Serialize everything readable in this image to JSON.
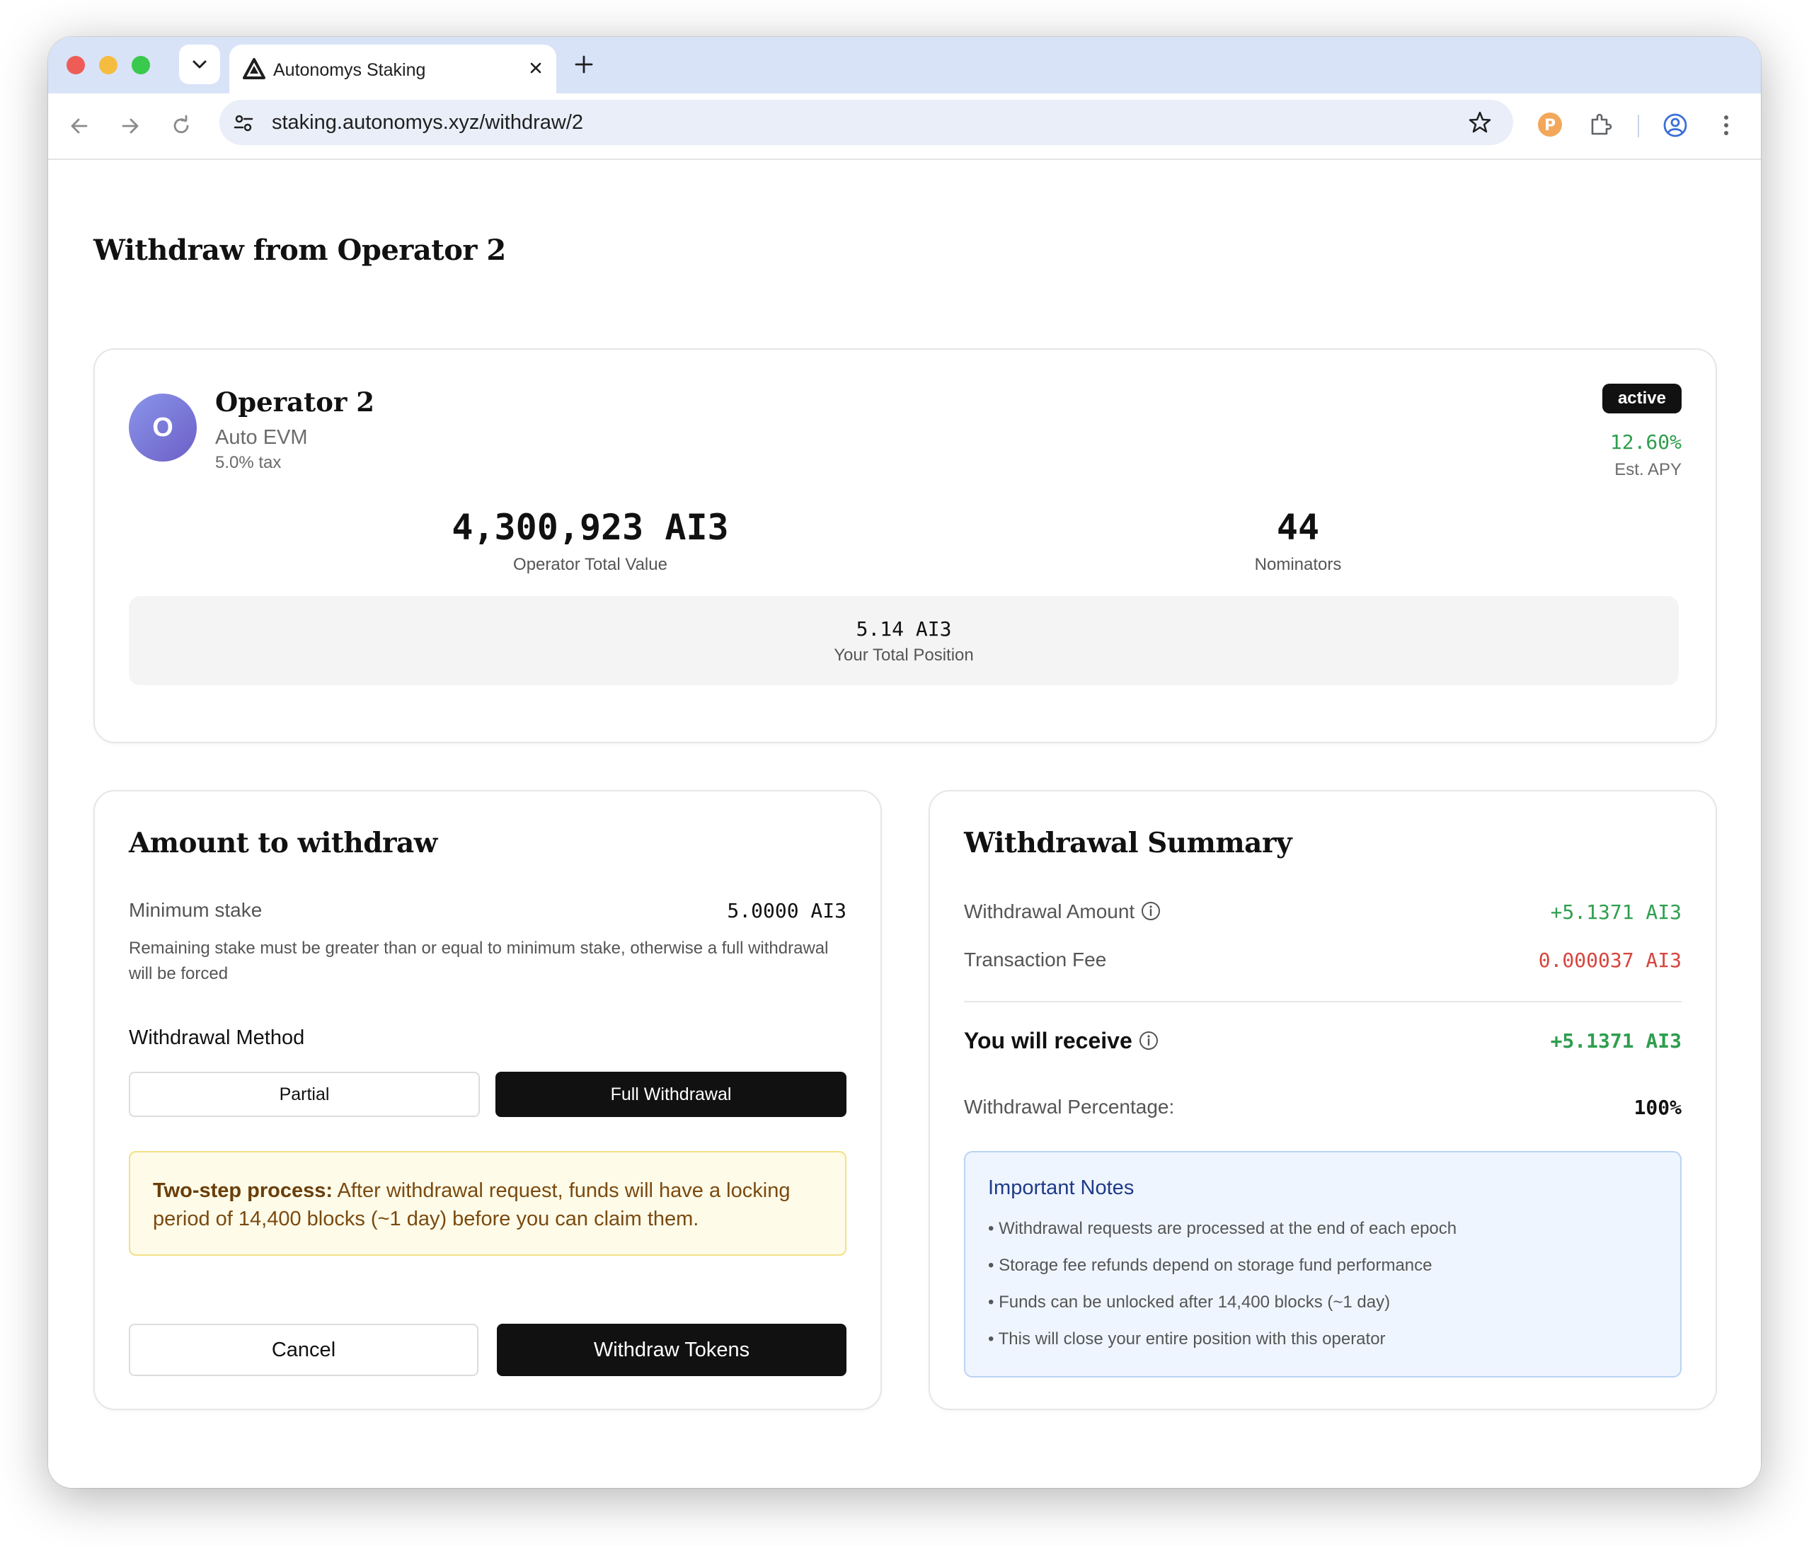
{
  "browser": {
    "tab_title": "Autonomys Staking",
    "url": "staking.autonomys.xyz/withdraw/2"
  },
  "page": {
    "title": "Withdraw from Operator 2"
  },
  "operator": {
    "avatar_letter": "O",
    "name": "Operator 2",
    "domain": "Auto EVM",
    "tax": "5.0% tax",
    "status": "active",
    "apy": "12.60%",
    "apy_label": "Est. APY",
    "total_value": "4,300,923 AI3",
    "total_value_label": "Operator Total Value",
    "nominators": "44",
    "nominators_label": "Nominators",
    "position": "5.14 AI3",
    "position_label": "Your Total Position"
  },
  "amount": {
    "title": "Amount to withdraw",
    "min_stake_label": "Minimum stake",
    "min_stake_value": "5.0000 AI3",
    "help": "Remaining stake must be greater than or equal to minimum stake, otherwise a full withdrawal will be forced",
    "method_label": "Withdrawal Method",
    "method_partial": "Partial",
    "method_full": "Full Withdrawal",
    "selected_method": "Full Withdrawal",
    "notice_strong": "Two-step process:",
    "notice_text": " After withdrawal request, funds will have a locking period of 14,400 blocks (~1 day) before you can claim them.",
    "cancel": "Cancel",
    "submit": "Withdraw Tokens"
  },
  "summary": {
    "title": "Withdrawal Summary",
    "amount_label": "Withdrawal Amount",
    "amount_value": "+5.1371 AI3",
    "fee_label": "Transaction Fee",
    "fee_value": "0.000037 AI3",
    "receive_label": "You will receive",
    "receive_value": "+5.1371 AI3",
    "percentage_label": "Withdrawal Percentage:",
    "percentage_value": "100%",
    "notes_title": "Important Notes",
    "notes": [
      "• Withdrawal requests are processed at the end of each epoch",
      "• Storage fee refunds depend on storage fund performance",
      "• Funds can be unlocked after 14,400 blocks (~1 day)",
      "• This will close your entire position with this operator"
    ]
  },
  "colors": {
    "positive": "#2f9e4e",
    "negative": "#d6453d",
    "primary": "#111111",
    "notice_bg": "#fefbe8",
    "notes_bg": "#eff5fe"
  },
  "icons": {
    "close_window": "red-traffic-light",
    "minimize_window": "yellow-traffic-light",
    "maximize_window": "green-traffic-light",
    "tab_favicon": "autonomys-logo-icon",
    "bookmark": "star-icon",
    "extension_p": "extension-p-icon",
    "extensions": "puzzle-icon",
    "profile": "account-circle-icon",
    "menu": "kebab-menu-icon"
  }
}
